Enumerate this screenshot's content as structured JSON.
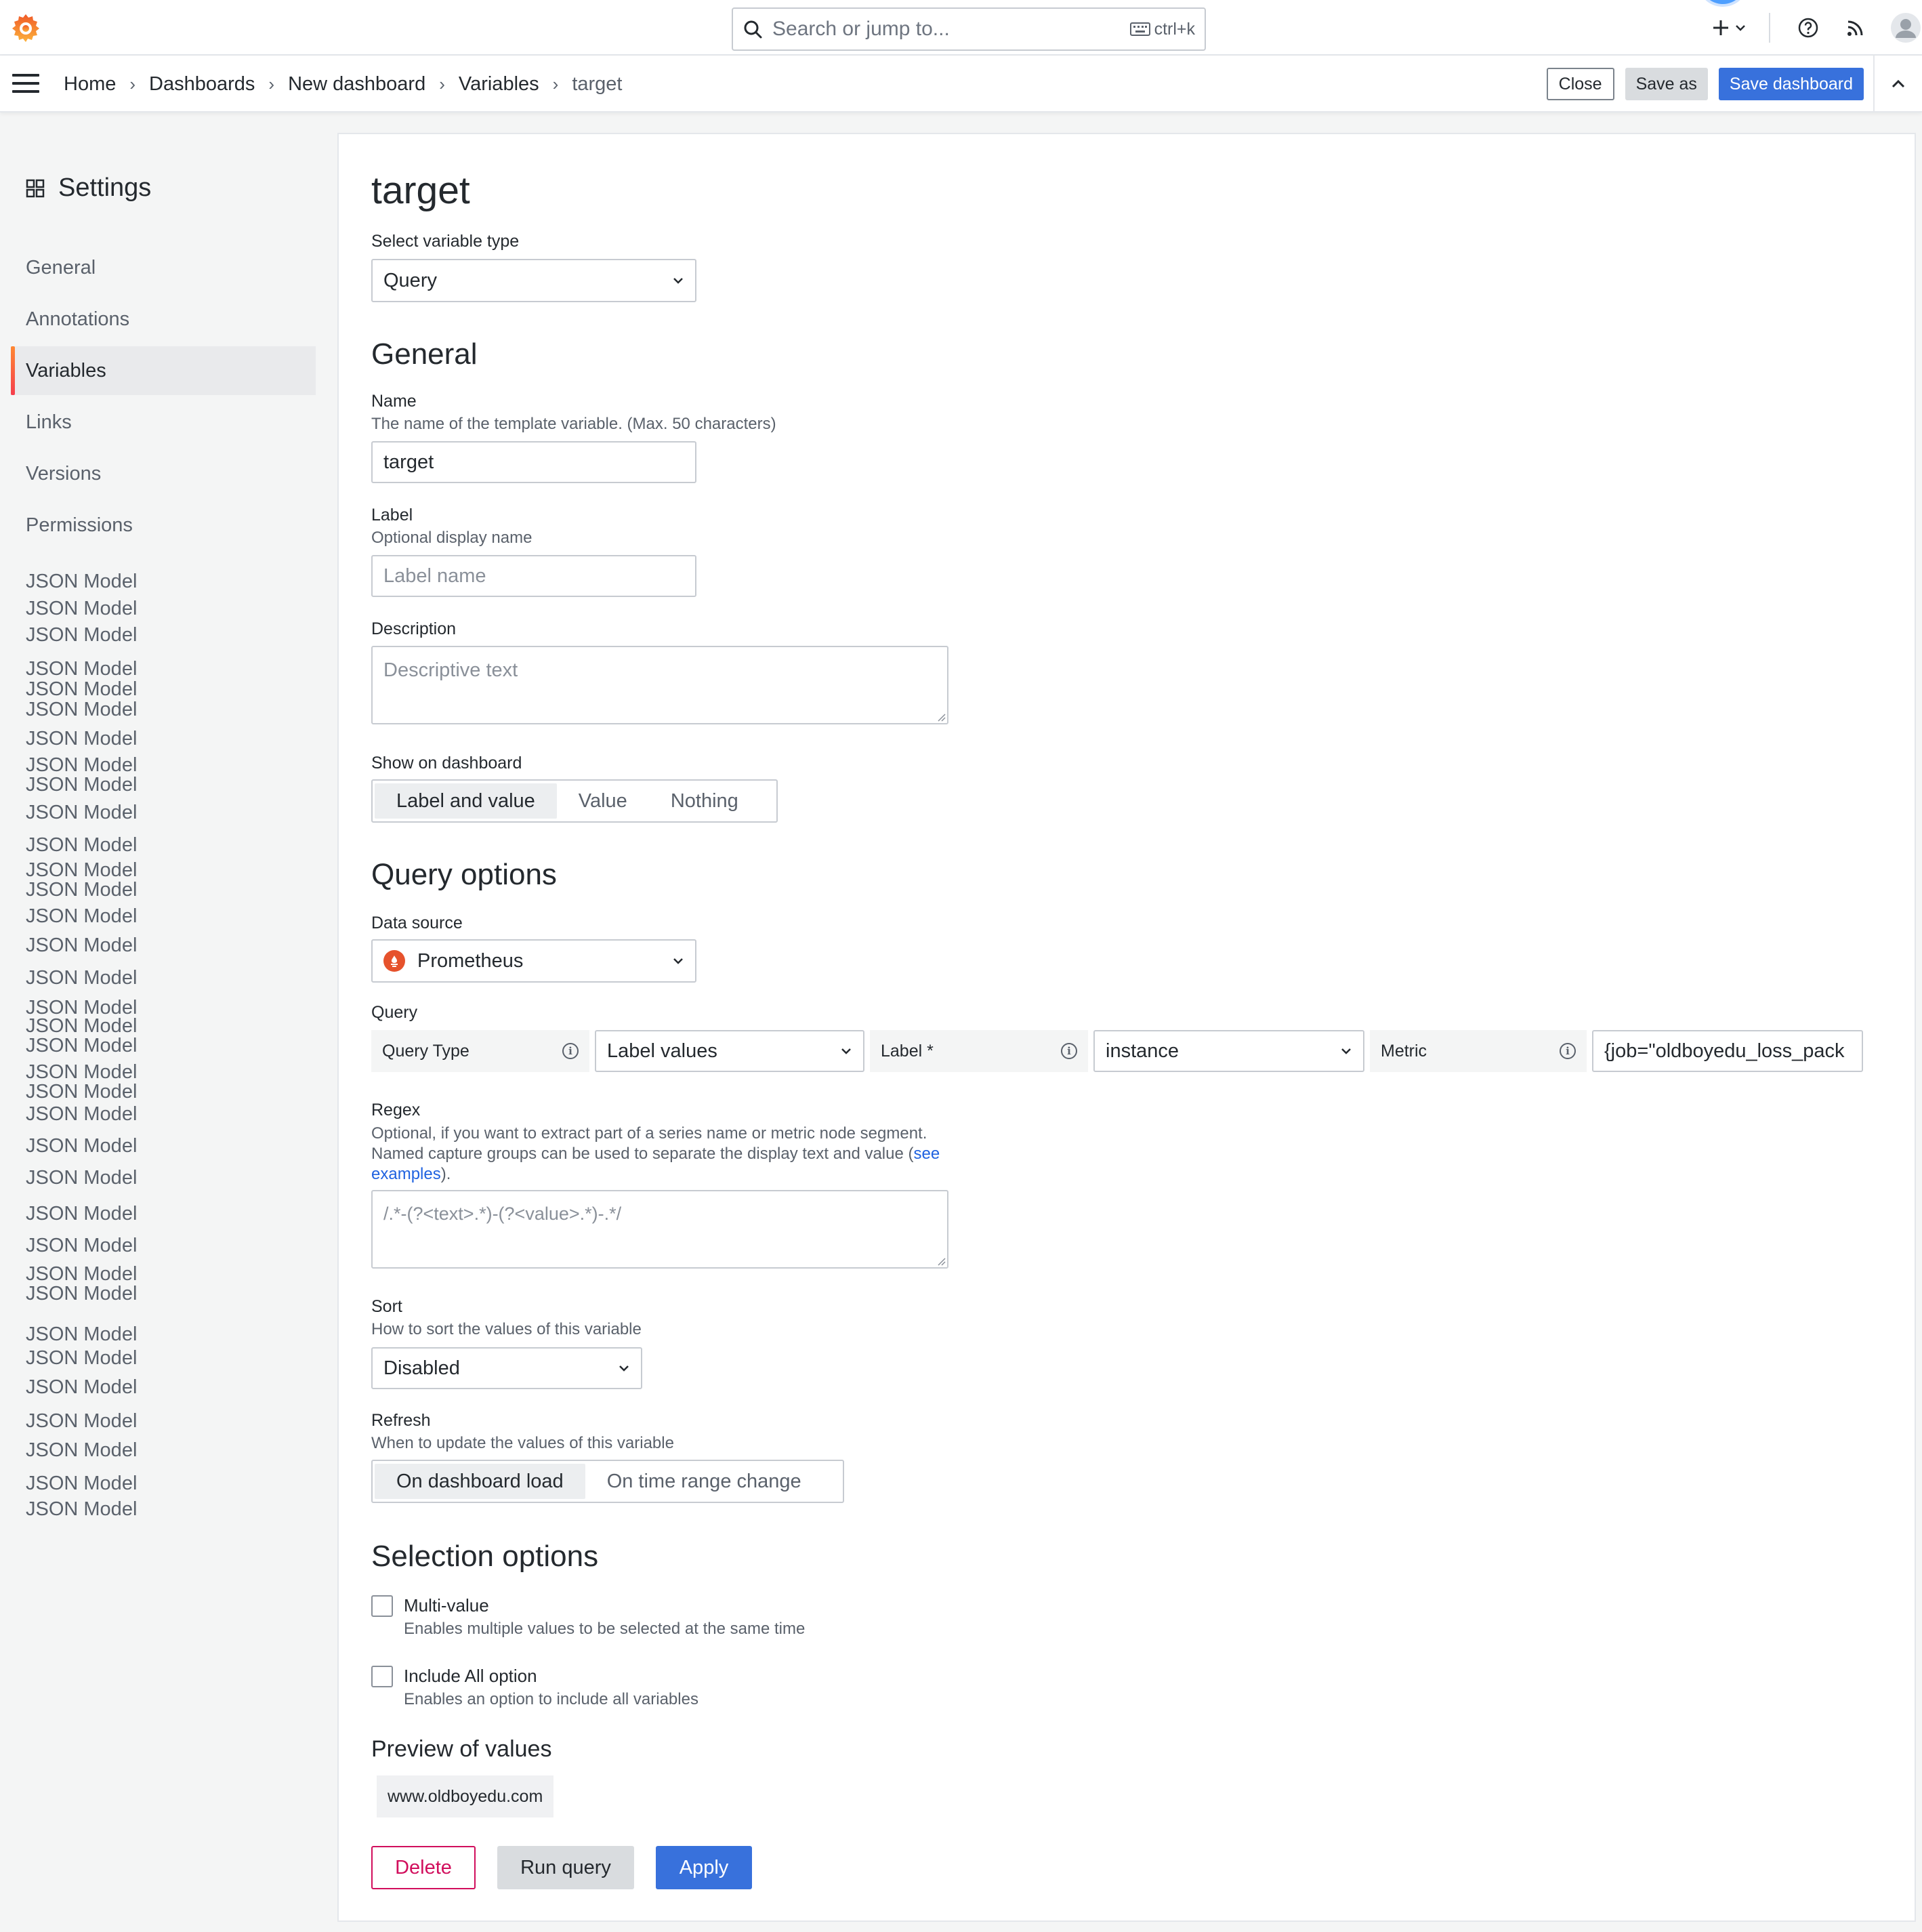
{
  "topbar": {
    "search_placeholder": "Search or jump to...",
    "shortcut": "ctrl+k"
  },
  "breadcrumb": {
    "items": [
      "Home",
      "Dashboards",
      "New dashboard",
      "Variables",
      "target"
    ]
  },
  "actions": {
    "close": "Close",
    "save_as": "Save as",
    "save_dashboard": "Save dashboard"
  },
  "sidebar": {
    "title": "Settings",
    "items": [
      "General",
      "Annotations",
      "Variables",
      "Links",
      "Versions",
      "Permissions"
    ],
    "active": "Variables",
    "json_model_label": "JSON Model"
  },
  "form": {
    "title": "target",
    "variable_type": {
      "label": "Select variable type",
      "value": "Query"
    },
    "general": {
      "heading": "General",
      "name": {
        "label": "Name",
        "description": "The name of the template variable. (Max. 50 characters)",
        "value": "target"
      },
      "label": {
        "label": "Label",
        "description": "Optional display name",
        "placeholder": "Label name"
      },
      "description": {
        "label": "Description",
        "placeholder": "Descriptive text"
      },
      "show_on_dashboard": {
        "label": "Show on dashboard",
        "options": [
          "Label and value",
          "Value",
          "Nothing"
        ],
        "selected": "Label and value"
      }
    },
    "query_options": {
      "heading": "Query options",
      "data_source": {
        "label": "Data source",
        "value": "Prometheus"
      },
      "query": {
        "label": "Query",
        "query_type_label": "Query Type",
        "query_type_value": "Label values",
        "label_label": "Label *",
        "label_value": "instance",
        "metric_label": "Metric",
        "metric_value": "{job=\"oldboyedu_loss_pack"
      },
      "regex": {
        "label": "Regex",
        "description_1": "Optional, if you want to extract part of a series name or metric node segment.",
        "description_2": "Named capture groups can be used to separate the display text and value (",
        "link_1": "see",
        "link_2": "examples",
        "description_end": ").",
        "placeholder": "/.*-(?<text>.*)-(?<value>.*)-.*/"
      },
      "sort": {
        "label": "Sort",
        "description": "How to sort the values of this variable",
        "value": "Disabled"
      },
      "refresh": {
        "label": "Refresh",
        "description": "When to update the values of this variable",
        "options": [
          "On dashboard load",
          "On time range change"
        ],
        "selected": "On dashboard load"
      }
    },
    "selection_options": {
      "heading": "Selection options",
      "multi_value": {
        "label": "Multi-value",
        "description": "Enables multiple values to be selected at the same time",
        "checked": false
      },
      "include_all": {
        "label": "Include All option",
        "description": "Enables an option to include all variables",
        "checked": false
      }
    },
    "preview": {
      "heading": "Preview of values",
      "values": [
        "www.oldboyedu.com"
      ]
    },
    "buttons": {
      "delete": "Delete",
      "run_query": "Run query",
      "apply": "Apply"
    }
  },
  "colors": {
    "primary": "#3871dc",
    "danger": "#d10e5c",
    "active_bar": "#f53e4c",
    "prometheus": "#e6522c"
  }
}
